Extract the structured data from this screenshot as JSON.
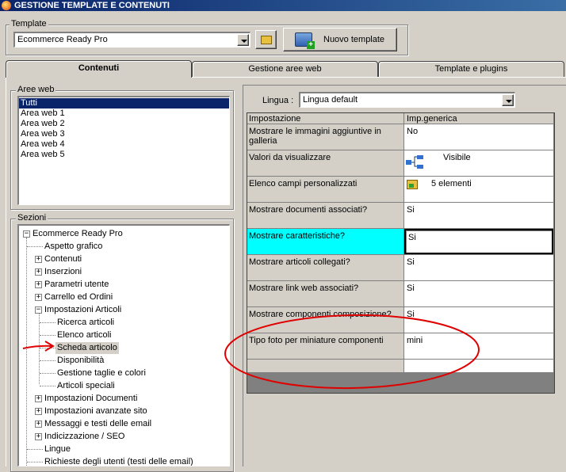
{
  "window": {
    "title": "GESTIONE TEMPLATE E CONTENUTI"
  },
  "template": {
    "legend": "Template",
    "selected": "Ecommerce Ready Pro",
    "new_button": "Nuovo template"
  },
  "tabs": [
    "Contenuti",
    "Gestione aree web",
    "Template e plugins"
  ],
  "aree_web": {
    "legend": "Aree web",
    "items": [
      "Tutti",
      "Area web 1",
      "Area web 2",
      "Area web 3",
      "Area web 4",
      "Area web 5"
    ]
  },
  "sezioni": {
    "legend": "Sezioni",
    "items": [
      "Ecommerce Ready Pro",
      "Aspetto grafico",
      "Contenuti",
      "Inserzioni",
      "Parametri utente",
      "Carrello ed Ordini",
      "Impostazioni Articoli",
      "Ricerca articoli",
      "Elenco articoli",
      "Scheda articolo",
      "Disponibilità",
      "Gestione taglie e colori",
      "Articoli speciali",
      "Impostazioni Documenti",
      "Impostazioni avanzate sito",
      "Messaggi e testi delle email",
      "Indicizzazione / SEO",
      "Lingue",
      "Richieste degli utenti (testi delle email)"
    ]
  },
  "lingua": {
    "label": "Lingua :",
    "selected": "Lingua default"
  },
  "grid": {
    "headers": [
      "Impostazione",
      "Imp.generica"
    ],
    "rows": [
      {
        "setting": "Mostrare le immagini aggiuntive in galleria",
        "value": "No"
      },
      {
        "setting": "Valori da visualizzare",
        "value": "Visibile"
      },
      {
        "setting": "Elenco campi personalizzati",
        "value": "5 elementi"
      },
      {
        "setting": "Mostrare documenti associati?",
        "value": "Si"
      },
      {
        "setting": "Mostrare caratteristiche?",
        "value": "Si"
      },
      {
        "setting": "Mostrare articoli collegati?",
        "value": "Si"
      },
      {
        "setting": "Mostrare link web associati?",
        "value": "Si"
      },
      {
        "setting": "Mostrare componenti composizione?",
        "value": "Si"
      },
      {
        "setting": "Tipo foto per miniature componenti",
        "value": "mini"
      }
    ]
  },
  "colors": {
    "selected_row": "#00ffff",
    "annotation": "#e00000",
    "title_bar": "#0a246a"
  }
}
